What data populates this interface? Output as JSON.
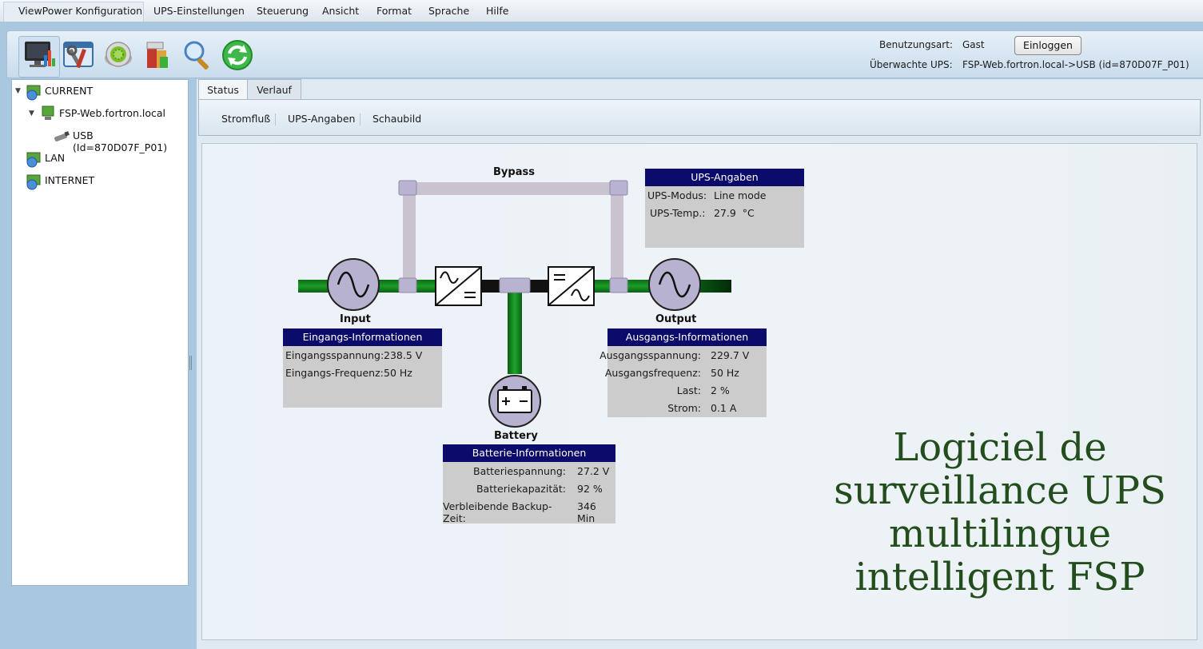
{
  "menu": {
    "items": [
      "ViewPower Konfiguration",
      "UPS-Einstellungen",
      "Steuerung",
      "Ansicht",
      "Format",
      "Sprache",
      "Hilfe"
    ]
  },
  "toolbar": {
    "icons": [
      "monitor-icon",
      "tools-icon",
      "settings-icon",
      "battery-pack-icon",
      "search-icon",
      "refresh-icon"
    ],
    "user_type_label": "Benutzungsart:",
    "user_type_value": "Gast",
    "login_label": "Einloggen",
    "monitored_label": "Überwachte UPS:",
    "monitored_value": "FSP-Web.fortron.local->USB (id=870D07F_P01)"
  },
  "tree": {
    "current": "CURRENT",
    "host": "FSP-Web.fortron.local",
    "device": "USB (Id=870D07F_P01)",
    "lan": "LAN",
    "internet": "INTERNET"
  },
  "tabs": [
    "Status",
    "Verlauf"
  ],
  "subnav": [
    "Stromfluß",
    "UPS-Angaben",
    "Schaubild"
  ],
  "diagram": {
    "bypass_label": "Bypass",
    "input_label": "Input",
    "output_label": "Output",
    "battery_label": "Battery",
    "ups_info": {
      "title": "UPS-Angaben",
      "rows": [
        {
          "label": "UPS-Modus:",
          "value": "Line mode"
        },
        {
          "label": "UPS-Temp.:",
          "value": "27.9  °C"
        }
      ]
    },
    "input_info": {
      "title": "Eingangs-Informationen",
      "rows": [
        {
          "label": "Eingangsspannung:",
          "value": "238.5 V"
        },
        {
          "label": "Eingangs-Frequenz:",
          "value": "50 Hz"
        }
      ]
    },
    "output_info": {
      "title": "Ausgangs-Informationen",
      "rows": [
        {
          "label": "Ausgangsspannung:",
          "value": "229.7 V"
        },
        {
          "label": "Ausgangsfrequenz:",
          "value": "50 Hz"
        },
        {
          "label": "Last:",
          "value": "2 %"
        },
        {
          "label": "Strom:",
          "value": "0.1 A"
        }
      ]
    },
    "battery_info": {
      "title": "Batterie-Informationen",
      "rows": [
        {
          "label": "Batteriespannung:",
          "value": "27.2 V"
        },
        {
          "label": "Batteriekapazität:",
          "value": "92 %"
        },
        {
          "label": "Verbleibende Backup-Zeit:",
          "value": "346 Min"
        }
      ]
    }
  },
  "promo": {
    "lines": [
      "Logiciel de",
      "surveillance UPS",
      "multilingue",
      "intelligent FSP"
    ]
  },
  "colors": {
    "line_green": "#0d7a19",
    "box_header": "#0b0b6b",
    "promo_text": "#234d1c"
  }
}
